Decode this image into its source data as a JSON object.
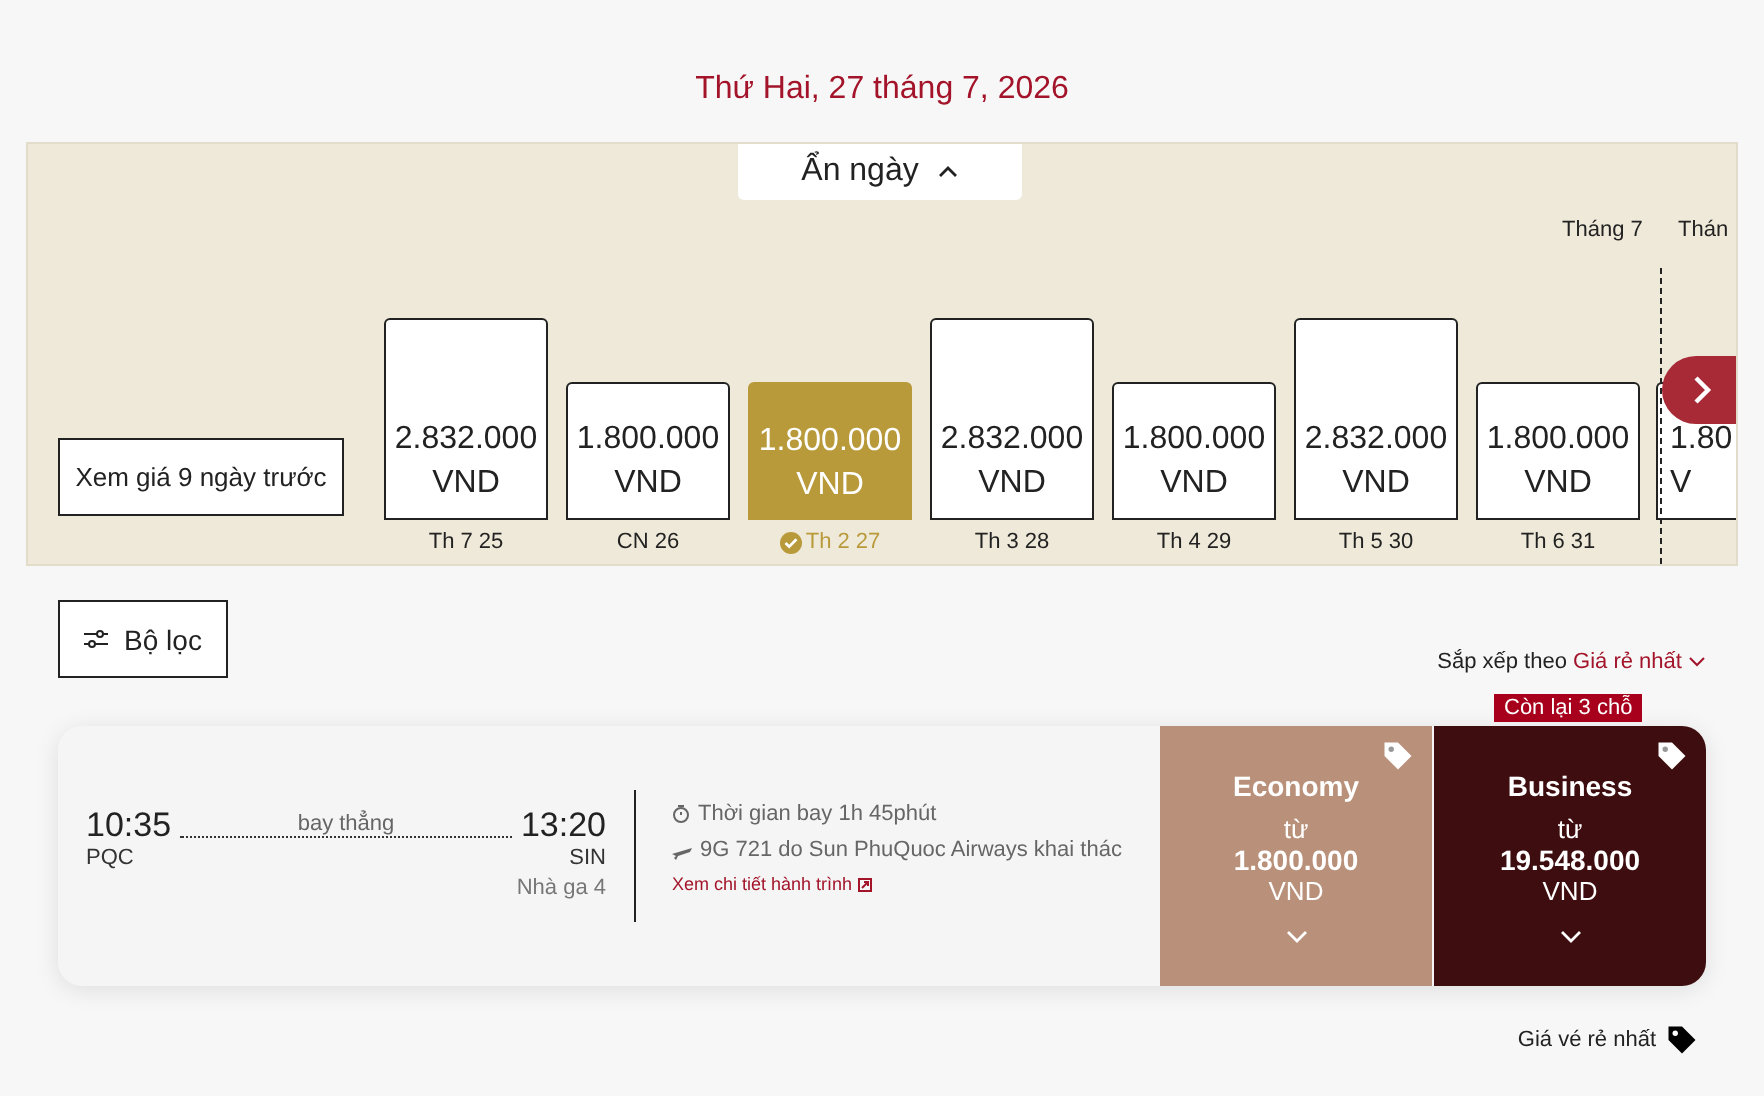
{
  "date_title": "Thứ Hai, 27 tháng 7, 2026",
  "calendar": {
    "toggle": "Ẩn ngày",
    "prev_button": "Xem giá 9 ngày trước",
    "month_label": "Tháng 7",
    "next_month_label": "Thán",
    "days": [
      {
        "kind": "tall",
        "price": "2.832.000",
        "currency": "VND",
        "label": "Th 7 25",
        "selected": false
      },
      {
        "kind": "short",
        "price": "1.800.000",
        "currency": "VND",
        "label": "CN 26",
        "selected": false
      },
      {
        "kind": "short",
        "price": "1.800.000",
        "currency": "VND",
        "label": "Th 2 27",
        "selected": true
      },
      {
        "kind": "tall",
        "price": "2.832.000",
        "currency": "VND",
        "label": "Th 3 28",
        "selected": false
      },
      {
        "kind": "short",
        "price": "1.800.000",
        "currency": "VND",
        "label": "Th 4 29",
        "selected": false
      },
      {
        "kind": "tall",
        "price": "2.832.000",
        "currency": "VND",
        "label": "Th 5 30",
        "selected": false
      },
      {
        "kind": "short",
        "price": "1.800.000",
        "currency": "VND",
        "label": "Th 6 31",
        "selected": false
      }
    ],
    "partial_day": {
      "kind": "short",
      "price": "1.80",
      "currency": "V"
    }
  },
  "filter_button": "Bộ lọc",
  "sort": {
    "label": "Sắp xếp theo",
    "value": "Giá rẻ nhất"
  },
  "flight": {
    "depart_time": "10:35",
    "depart_airport": "PQC",
    "stops": "bay thẳng",
    "arrive_time": "13:20",
    "arrive_airport": "SIN",
    "arrive_terminal": "Nhà ga 4",
    "duration": "Thời gian bay  1h 45phút",
    "operator": "9G 721 do Sun PhuQuoc Airways khai thác",
    "details_link": "Xem chi tiết hành trình",
    "fares": [
      {
        "cabin": "Economy",
        "from": "từ",
        "price": "1.800.000",
        "currency": "VND",
        "color": "#b9917a"
      },
      {
        "cabin": "Business",
        "from": "từ",
        "price": "19.548.000",
        "currency": "VND",
        "color": "#3e0d10",
        "badge": "Còn lại 3 chỗ"
      }
    ]
  },
  "legend": "Giá vé rẻ nhất"
}
